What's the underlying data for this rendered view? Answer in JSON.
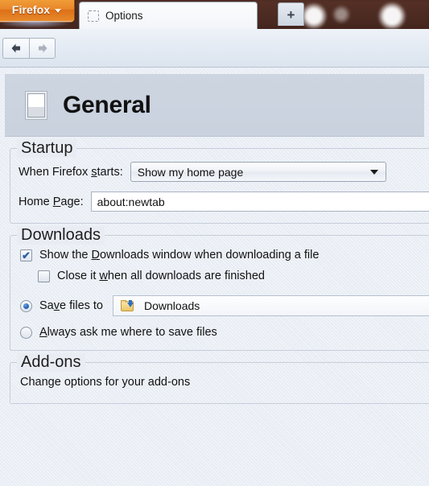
{
  "window": {
    "firefox_button_label": "Firefox",
    "tab": {
      "title": "Options",
      "favicon": "placeholder-favicon"
    },
    "new_tab_label": "+",
    "nav": {
      "back_icon": "back-arrow-icon",
      "forward_icon": "forward-arrow-icon"
    }
  },
  "page": {
    "icon": "general-pane-icon",
    "title": "General"
  },
  "startup": {
    "group_title": "Startup",
    "when_starts_label_pre": "When Firefox ",
    "when_starts_label_accel": "s",
    "when_starts_label_post": "tarts:",
    "when_starts_value": "Show my home page",
    "home_page_label_pre": "Home ",
    "home_page_label_accel": "P",
    "home_page_label_post": "age:",
    "home_page_value": "about:newtab"
  },
  "downloads": {
    "group_title": "Downloads",
    "show_window_pre": "Show the ",
    "show_window_accel": "D",
    "show_window_post": "ownloads window when downloading a file",
    "show_window_checked": "✔",
    "close_when_done_pre": "Close it ",
    "close_when_done_accel": "w",
    "close_when_done_post": "hen all downloads are finished",
    "save_files_pre": "Sa",
    "save_files_accel": "v",
    "save_files_post": "e files to",
    "save_folder_icon": "download-folder-icon",
    "save_folder_value": "Downloads",
    "always_ask_pre": "",
    "always_ask_accel": "A",
    "always_ask_post": "lways ask me where to save files"
  },
  "addons": {
    "group_title": "Add-ons",
    "description": "Change options for your add-ons"
  }
}
